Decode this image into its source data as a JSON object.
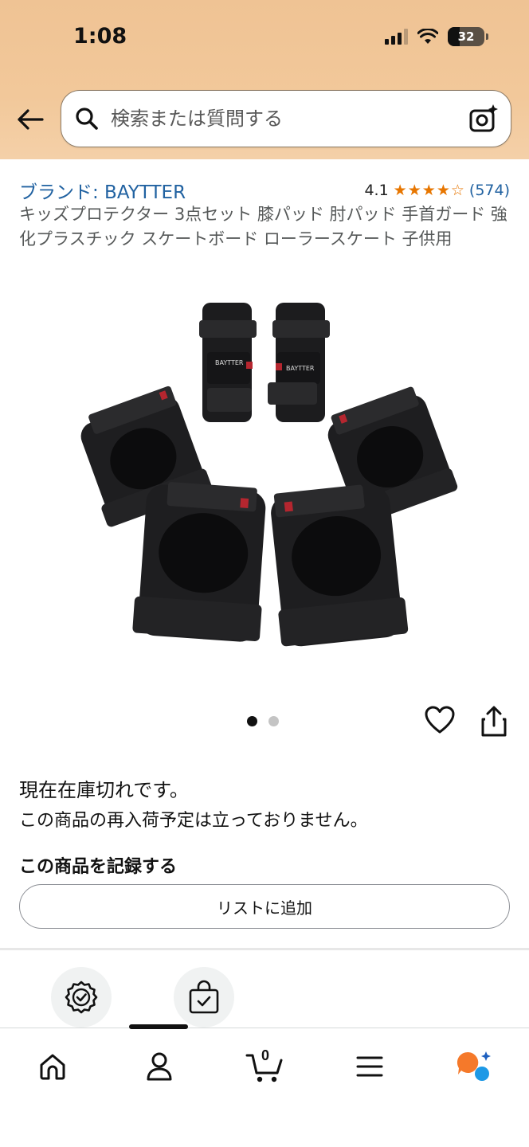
{
  "status_bar": {
    "time": "1:08",
    "battery": "32"
  },
  "search": {
    "placeholder": "検索または質問する"
  },
  "product": {
    "brand": "ブランド: BAYTTER",
    "rating": "4.1",
    "rating_stars": 4.1,
    "rating_count": "(574)",
    "title": "キッズプロテクター 3点セット 膝パッド 肘パッド 手首ガード 強化プラスチック スケートボード ローラースケート 子供用",
    "image_label": "BAYTTER",
    "image_count": 2,
    "image_index": 1
  },
  "stock": {
    "status": "現在在庫切れです。",
    "restock": "この商品の再入荷予定は立っておりません。"
  },
  "record": {
    "heading": "この商品を記録する",
    "add_list_label": "リストに追加"
  },
  "nav": {
    "items": [
      {
        "icon": "home-icon"
      },
      {
        "icon": "account-icon"
      },
      {
        "icon": "cart-icon",
        "count": "0"
      },
      {
        "icon": "menu-icon"
      },
      {
        "icon": "rufus-icon"
      }
    ]
  },
  "colors": {
    "header_bg": "#f2c89a",
    "link": "#2162a1",
    "star": "#e77600"
  }
}
